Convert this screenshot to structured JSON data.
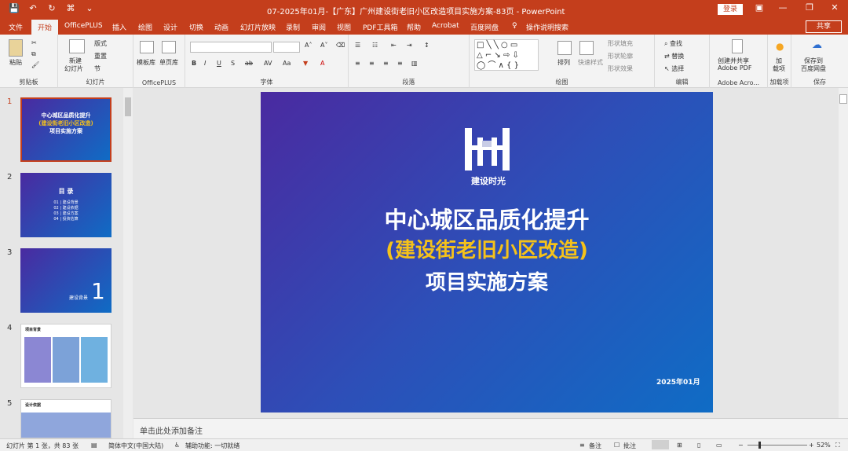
{
  "titlebar": {
    "doc_title": "07-2025年01月-【广东】广州建设街老旧小区改造项目实施方案-83页  -  PowerPoint",
    "login_label": "登录",
    "min_icon": "minimize-icon",
    "restore_icon": "restore-icon",
    "close_icon": "close-icon"
  },
  "tabs": [
    "文件",
    "开始",
    "OfficePLUS",
    "插入",
    "绘图",
    "设计",
    "切换",
    "动画",
    "幻灯片放映",
    "录制",
    "审阅",
    "视图",
    "PDF工具箱",
    "帮助",
    "Acrobat",
    "百度网盘",
    "操作说明搜索"
  ],
  "share_label": "共享",
  "ribbon": {
    "clipboard": {
      "paste": "粘贴",
      "label": "剪贴板"
    },
    "slides": {
      "new_slide": "新建",
      "new_slide2": "幻灯片",
      "layout": "版式",
      "reset": "重置",
      "section": "节",
      "label": "幻灯片"
    },
    "officeplus": {
      "template": "模板库",
      "single": "单页库",
      "label": "OfficePLUS"
    },
    "font": {
      "label": "字体"
    },
    "paragraph": {
      "label": "段落"
    },
    "drawing": {
      "arrange": "排列",
      "quick_styles": "快速样式",
      "fill": "形状填充",
      "outline": "形状轮廓",
      "effect": "形状效果",
      "label": "绘图"
    },
    "editing": {
      "find": "查找",
      "replace": "替换",
      "select": "选择",
      "label": "编辑"
    },
    "adobe": {
      "line1": "创建并共享",
      "line2": "Adobe PDF",
      "label": "Adobe Acro..."
    },
    "addins": {
      "line1": "加",
      "line2": "载项",
      "label": "加载项"
    },
    "save": {
      "line1": "保存到",
      "line2": "百度网盘",
      "label": "保存"
    }
  },
  "thumbnails": [
    {
      "num": "1",
      "title": "中心城区品质化提升",
      "sub": "(建设街老旧小区改造)",
      "sub2": "项目实施方案"
    },
    {
      "num": "2",
      "title": "目 录",
      "items": [
        "01 | 建设背景",
        "02 | 建设依据",
        "03 | 建设方案",
        "04 | 投资估算"
      ]
    },
    {
      "num": "3",
      "label": "建设背景",
      "big": "1"
    },
    {
      "num": "4",
      "title": "项目背景"
    },
    {
      "num": "5",
      "title": "设计依据"
    }
  ],
  "slide": {
    "logo_text": "建设时光",
    "title_line1": "中心城区品质化提升",
    "title_line2": "(建设街老旧小区改造)",
    "title_line3": "项目实施方案",
    "date": "2025年01月"
  },
  "notes_placeholder": "单击此处添加备注",
  "status": {
    "slide_info": "幻灯片 第 1 张，共 83 张",
    "language": "简体中文(中国大陆)",
    "accessibility": "辅助功能: 一切就绪",
    "notes": "备注",
    "comments": "批注",
    "zoom": "52%"
  },
  "colors": {
    "accent": "#c43e1c",
    "slide_gold": "#f5c21a"
  }
}
